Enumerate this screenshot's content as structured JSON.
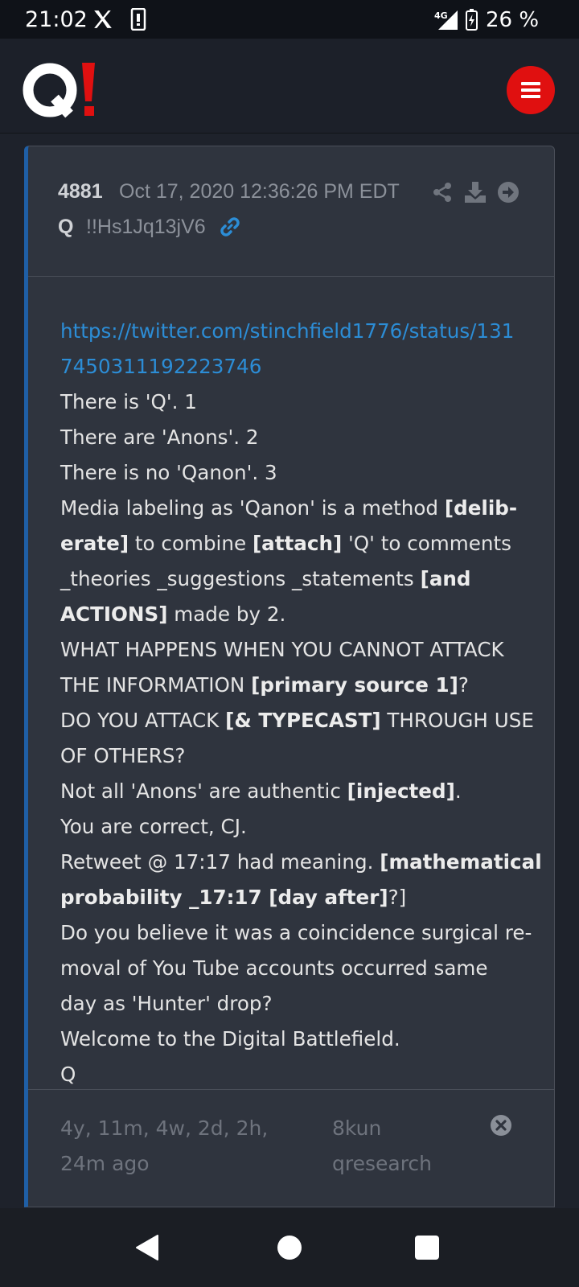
{
  "status_bar": {
    "time": "21:02",
    "network": "4G",
    "battery": "26 %"
  },
  "header": {
    "logo_text": "Q!",
    "menu_icon": "hamburger-icon"
  },
  "post": {
    "number": "4881",
    "date": "Oct 17, 2020 12:36:26 PM EDT",
    "author": "Q",
    "tripcode": "!!Hs1Jq13jV6",
    "action_icons": [
      "share-icon",
      "download-icon",
      "arrow-right-circle-icon"
    ],
    "body_lines": [
      [
        {
          "t": "https://twitter.com/stinchfield1776/status/131",
          "s": "link"
        }
      ],
      [
        {
          "t": "7450311192223746",
          "s": "link"
        }
      ],
      [
        {
          "t": "There is 'Q'. 1"
        }
      ],
      [
        {
          "t": "There are 'Anons'. 2"
        }
      ],
      [
        {
          "t": "There is no 'Qanon'. 3"
        }
      ],
      [
        {
          "t": "Media labeling as 'Qanon' is a method "
        },
        {
          "t": "[delib-",
          "s": "b"
        }
      ],
      [
        {
          "t": "erate]",
          "s": "b"
        },
        {
          "t": " to combine "
        },
        {
          "t": "[attach]",
          "s": "b"
        },
        {
          "t": " 'Q' to comments"
        }
      ],
      [
        {
          "t": "_theories _suggestions _statements "
        },
        {
          "t": "[and",
          "s": "b"
        }
      ],
      [
        {
          "t": "ACTIONS]",
          "s": "b"
        },
        {
          "t": " made by 2."
        }
      ],
      [
        {
          "t": "WHAT HAPPENS WHEN YOU CANNOT ATTACK"
        }
      ],
      [
        {
          "t": "THE INFORMATION "
        },
        {
          "t": "[primary source 1]",
          "s": "b"
        },
        {
          "t": "?"
        }
      ],
      [
        {
          "t": "DO YOU ATTACK "
        },
        {
          "t": "[& TYPECAST]",
          "s": "b"
        },
        {
          "t": " THROUGH USE"
        }
      ],
      [
        {
          "t": "OF OTHERS?"
        }
      ],
      [
        {
          "t": "Not all 'Anons' are authentic "
        },
        {
          "t": "[injected]",
          "s": "b"
        },
        {
          "t": "."
        }
      ],
      [
        {
          "t": "You are correct, CJ."
        }
      ],
      [
        {
          "t": "Retweet @ 17:17 had meaning. "
        },
        {
          "t": "[mathematical",
          "s": "b"
        }
      ],
      [
        {
          "t": "probability _17:17 [day after]",
          "s": "b"
        },
        {
          "t": "?]"
        }
      ],
      [
        {
          "t": "Do you believe it was a coincidence surgical re-"
        }
      ],
      [
        {
          "t": "moval of You Tube accounts occurred same"
        }
      ],
      [
        {
          "t": "day as 'Hunter' drop?"
        }
      ],
      [
        {
          "t": "Welcome to the Digital Battlefield."
        }
      ],
      [
        {
          "t": "Q"
        }
      ]
    ],
    "footer": {
      "ago": "4y, 11m, 4w, 2d, 2h, 24m ago",
      "source_board": "8kun",
      "source_name": "qresearch",
      "close_icon": "close-circle-icon"
    }
  },
  "colors": {
    "brand_red": "#e01010",
    "link_blue": "#2c8dd6",
    "accent_border": "#1f5fa6"
  }
}
